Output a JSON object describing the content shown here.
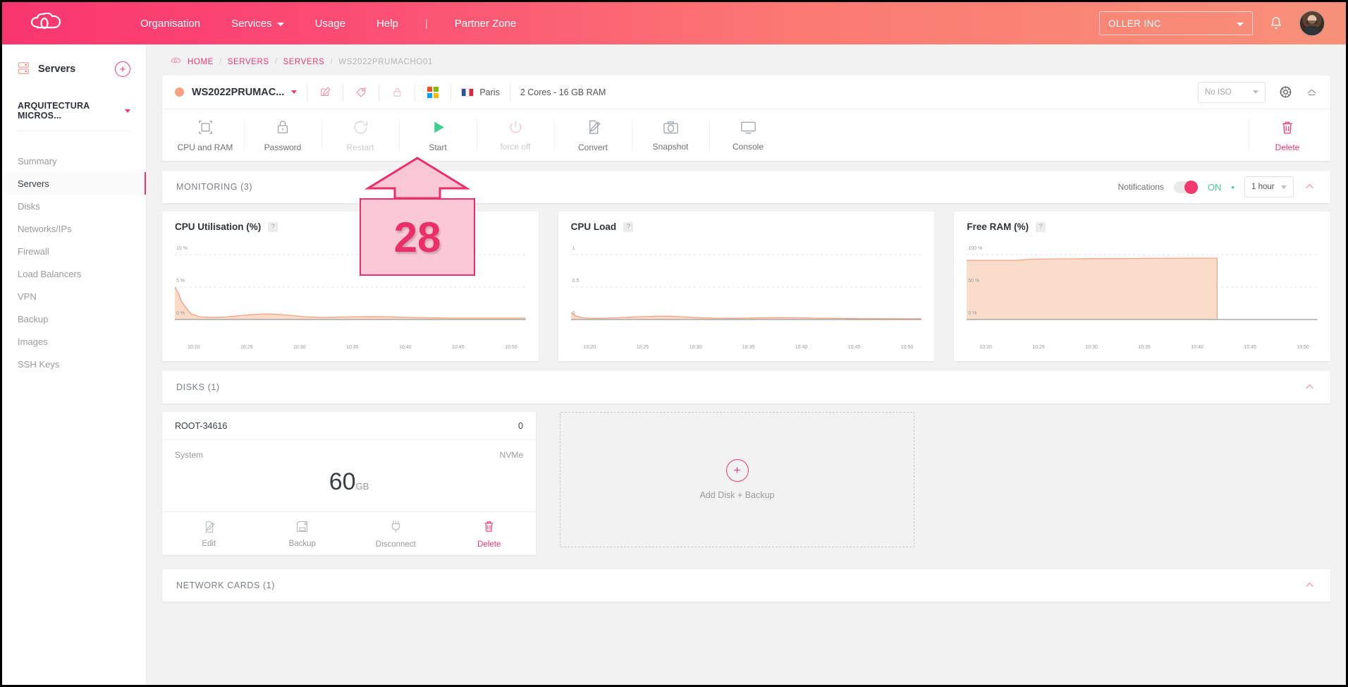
{
  "topbar": {
    "logo_icon": "cloud-logo-icon",
    "nav": [
      {
        "label": "Organisation",
        "has_caret": false
      },
      {
        "label": "Services",
        "has_caret": true
      },
      {
        "label": "Usage",
        "has_caret": false
      },
      {
        "label": "Help",
        "has_caret": false
      }
    ],
    "separator": "|",
    "partner_zone": "Partner Zone",
    "org_selector": "OLLER INC",
    "bell_icon": "notification-bell-icon",
    "avatar_icon": "user-avatar"
  },
  "sidebar": {
    "header_icon": "servers-icon",
    "header_title": "Servers",
    "add_label": "+",
    "project": "ARQUITECTURA MICROS...",
    "items": [
      {
        "label": "Summary",
        "active": false
      },
      {
        "label": "Servers",
        "active": true
      },
      {
        "label": "Disks",
        "active": false
      },
      {
        "label": "Networks/IPs",
        "active": false
      },
      {
        "label": "Firewall",
        "active": false
      },
      {
        "label": "Load Balancers",
        "active": false
      },
      {
        "label": "VPN",
        "active": false
      },
      {
        "label": "Backup",
        "active": false
      },
      {
        "label": "Images",
        "active": false
      },
      {
        "label": "SSH Keys",
        "active": false
      }
    ]
  },
  "breadcrumb": {
    "icon": "cloud-icon",
    "home": "HOME",
    "sep1": "/",
    "servers1": "SERVERS",
    "sep2": "/",
    "servers2": "SERVERS",
    "sep3": "/",
    "current": "WS2022PRUMACHO01"
  },
  "server": {
    "status_color": "#f8a07f",
    "name": "WS2022PRUMAC...",
    "edit_icon": "edit-icon",
    "tag_icon": "tag-icon",
    "lock_icon": "lock-icon",
    "os_icon": "windows-icon",
    "flag_icon": "france-flag-icon",
    "location": "Paris",
    "specs": "2 Cores - 16 GB RAM",
    "iso_value": "No ISO",
    "gear_icon": "gear-icon",
    "collapse_icon": "chevron-up-icon",
    "actions": [
      {
        "label": "CPU and RAM",
        "icon": "resize-icon",
        "disabled": false
      },
      {
        "label": "Password",
        "icon": "lock-icon",
        "disabled": false
      },
      {
        "label": "Restart",
        "icon": "restart-icon",
        "disabled": true
      },
      {
        "label": "Start",
        "icon": "play-icon",
        "disabled": false
      },
      {
        "label": "force off",
        "icon": "power-icon",
        "disabled": true
      },
      {
        "label": "Convert",
        "icon": "convert-icon",
        "disabled": false
      },
      {
        "label": "Snapshot",
        "icon": "camera-icon",
        "disabled": false
      },
      {
        "label": "Console",
        "icon": "monitor-icon",
        "disabled": false
      }
    ],
    "delete_label": "Delete",
    "delete_icon": "trash-icon"
  },
  "monitoring": {
    "title": "MONITORING (3)",
    "notifications_label": "Notifications",
    "toggle_state": "ON",
    "toggle_dot": "•",
    "range": "1 hour",
    "collapse_icon": "chevron-up-icon"
  },
  "chart_data": [
    {
      "type": "area",
      "title": "CPU Utilisation (%)",
      "help_icon": "?",
      "ylabel": "",
      "xlabel": "",
      "yticks": [
        "10 %",
        "5 %",
        "0 %"
      ],
      "ylim": [
        0,
        12
      ],
      "xticks": [
        "10:20",
        "10:25",
        "10:30",
        "10:35",
        "10:40",
        "10:45",
        "10:50"
      ],
      "grid": true,
      "legend": "none",
      "series": [
        {
          "name": "CPU Utilisation",
          "color": "#f4a484",
          "values": [
            4.2,
            2.4,
            1.1,
            0.5,
            0.35,
            0.3,
            0.3,
            0.35,
            0.45,
            0.6,
            0.75,
            0.8,
            0.7,
            0.5,
            0.35,
            0.3,
            0.3,
            0.35,
            0.4,
            0.35,
            0.3,
            0.25,
            0.2,
            0.2,
            0.2
          ]
        }
      ]
    },
    {
      "type": "area",
      "title": "CPU Load",
      "help_icon": "?",
      "ylabel": "",
      "xlabel": "",
      "yticks": [
        "1",
        "0.5",
        "0"
      ],
      "ylim": [
        0,
        1.2
      ],
      "xticks": [
        "10:20",
        "10:25",
        "10:30",
        "10:35",
        "10:40",
        "10:45",
        "10:50"
      ],
      "grid": true,
      "legend": "none",
      "series": [
        {
          "name": "CPU Load",
          "color": "#f4a484",
          "values": [
            0.09,
            0.05,
            0.02,
            0.015,
            0.02,
            0.03,
            0.04,
            0.05,
            0.055,
            0.05,
            0.03,
            0.02,
            0.02,
            0.02,
            0.025,
            0.03,
            0.03,
            0.025,
            0.02,
            0.015,
            0.01,
            0.01,
            0.01,
            0.01,
            0.01
          ]
        }
      ]
    },
    {
      "type": "area",
      "title": "Free RAM (%)",
      "help_icon": "?",
      "ylabel": "",
      "xlabel": "",
      "yticks": [
        "100 %",
        "50 %",
        "0 %"
      ],
      "ylim": [
        0,
        115
      ],
      "xticks": [
        "10:20",
        "10:25",
        "10:30",
        "10:35",
        "10:40",
        "10:45",
        "10:50"
      ],
      "grid": true,
      "legend": "none",
      "series": [
        {
          "name": "Free RAM",
          "color": "#f9cdb9",
          "values": [
            92,
            92,
            92,
            92.3,
            92.5,
            92.6,
            92.7,
            92.8,
            92.8,
            92.8,
            92.8,
            92.8,
            92.8,
            92.8,
            92.8,
            92.8,
            92.8,
            92.8,
            92.8,
            92.8,
            null,
            null,
            null,
            null,
            null
          ]
        }
      ]
    }
  ],
  "disks": {
    "title": "DISKS (1)",
    "collapse_icon": "chevron-up-icon",
    "card": {
      "name": "ROOT-34616",
      "number": "0",
      "type_left": "System",
      "type_right": "NVMe",
      "size": "60",
      "unit": "GB",
      "actions": [
        {
          "label": "Edit",
          "icon": "edit-icon",
          "danger": false
        },
        {
          "label": "Backup",
          "icon": "backup-icon",
          "danger": false
        },
        {
          "label": "Disconnect",
          "icon": "plug-icon",
          "danger": false
        },
        {
          "label": "Delete",
          "icon": "trash-icon",
          "danger": true
        }
      ]
    },
    "add": {
      "plus": "+",
      "label": "Add Disk + Backup"
    }
  },
  "network_cards": {
    "title": "NETWORK CARDS (1)",
    "collapse_icon": "chevron-up-icon"
  },
  "annotation": {
    "number": "28",
    "arrow_icon": "arrow-up-annotation"
  },
  "colors": {
    "brand_pink": "#f4376e",
    "accent_green": "#3ecf8e",
    "chart_orange": "#f4a484",
    "annotation_fill": "#fbc8d6",
    "annotation_stroke": "#ec2f68"
  }
}
